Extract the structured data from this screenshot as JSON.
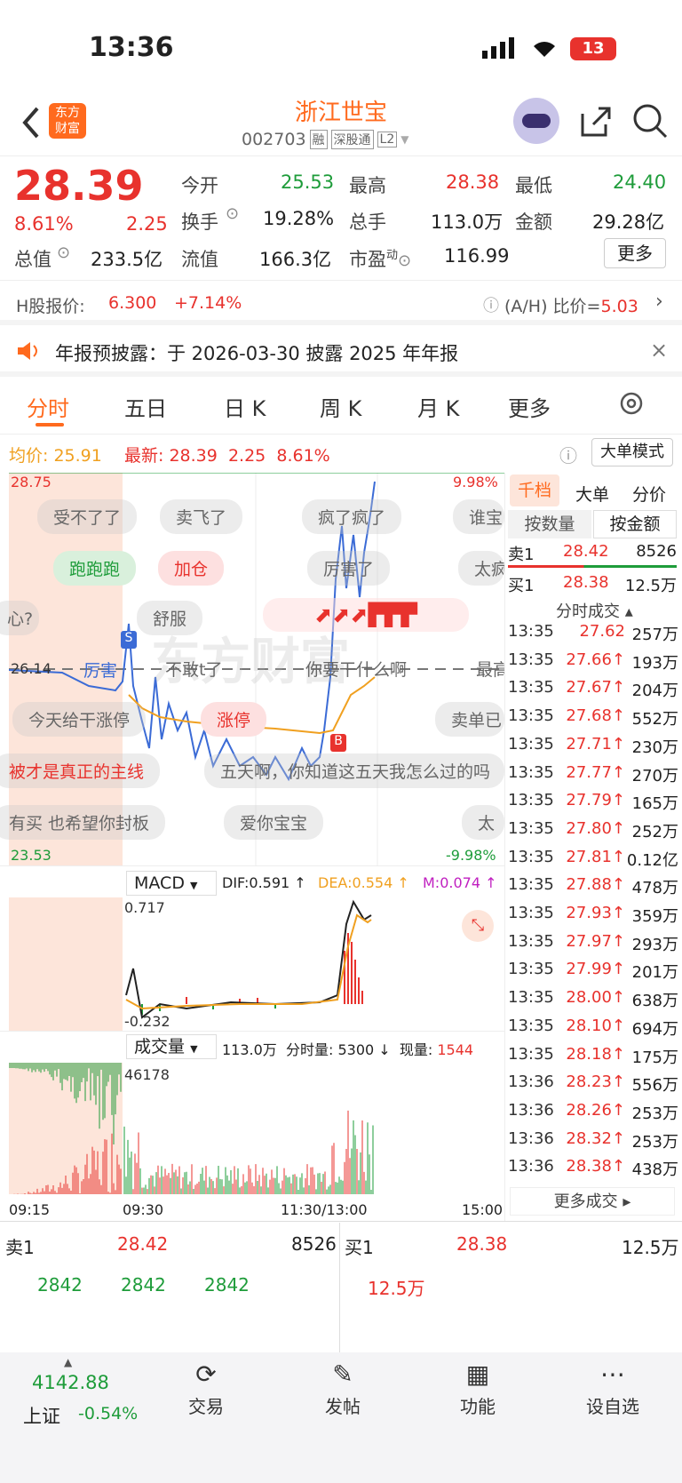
{
  "status": {
    "time": "13:36",
    "battery": "13"
  },
  "header": {
    "logo_line1": "东方",
    "logo_line2": "财富",
    "title": "浙江世宝",
    "code": "002703",
    "tag1": "融",
    "tag2": "深股通",
    "tag3": "L2"
  },
  "quote": {
    "price": "28.39",
    "pct": "8.61%",
    "chg": "2.25",
    "today_open_label": "今开",
    "today_open": "25.53",
    "high_label": "最高",
    "high": "28.38",
    "low_label": "最低",
    "low": "24.40",
    "turnover_label": "换手",
    "turnover": "19.28%",
    "vol_label": "总手",
    "vol": "113.0万",
    "amount_label": "金额",
    "amount": "29.28亿",
    "mcap_label": "总值",
    "mcap": "233.5亿",
    "float_label": "流值",
    "float": "166.3亿",
    "pe_label": "市盈",
    "pe_sup": "动",
    "pe": "116.99",
    "more": "更多"
  },
  "h_share": {
    "label": "H股报价:",
    "price": "6.300",
    "pct": "+7.14%",
    "ah_label": "(A/H) 比价=",
    "ah": "5.03"
  },
  "notice": {
    "text": "年报预披露：于 2026-03-30 披露 2025 年年报"
  },
  "tabs": [
    "分时",
    "五日",
    "日 K",
    "周 K",
    "月 K",
    "更多"
  ],
  "chart_header": {
    "avg_label": "均价:",
    "avg": "25.91",
    "latest_label": "最新:",
    "latest": "28.39",
    "chg": "2.25",
    "pct": "8.61%",
    "mode": "大单模式"
  },
  "chart_labels": {
    "top": "28.75",
    "bottom": "23.53",
    "top_pct": "9.98%",
    "bottom_pct": "-9.98%",
    "ref": "26.14",
    "s": "S",
    "b": "B",
    "watermark": "东方财富"
  },
  "bullets": [
    "受不了了",
    "卖飞了",
    "疯了疯了",
    "谁宝",
    "跑跑跑",
    "加仓",
    "厉害了",
    "太疯",
    "心?",
    "舒服",
    "厉害",
    "不敢t了",
    "你要干什么啊",
    "最高",
    "今天给干涨停",
    "涨停",
    "卖单已",
    "被才是真正的主线",
    "五天啊，你知道这五天我怎么过的吗",
    "有买 也希望你封板",
    "爱你宝宝",
    "太"
  ],
  "macd": {
    "label": "MACD",
    "dif": "DIF:0.591 ↑",
    "dea": "DEA:0.554 ↑",
    "m": "M:0.074 ↑",
    "top": "0.717",
    "bottom": "-0.232"
  },
  "volume": {
    "label": "成交量",
    "total": "113.0万",
    "fs": "分时量: 5300 ↓",
    "cur_label": "现量:",
    "cur": "1544",
    "top": "46178"
  },
  "time_axis": [
    "09:15",
    "09:30",
    "11:30/13:00",
    "15:00"
  ],
  "side": {
    "tabs": [
      "千档",
      "大单",
      "分价"
    ],
    "sub": [
      "按数量",
      "按金额"
    ],
    "sell1": {
      "label": "卖1",
      "price": "28.42",
      "vol": "8526"
    },
    "buy1": {
      "label": "买1",
      "price": "28.38",
      "vol": "12.5万"
    },
    "ticks_title": "分时成交",
    "more": "更多成交"
  },
  "ticks": [
    [
      "13:35",
      "27.62",
      "257万"
    ],
    [
      "13:35",
      "27.66↑",
      "193万"
    ],
    [
      "13:35",
      "27.67↑",
      "204万"
    ],
    [
      "13:35",
      "27.68↑",
      "552万"
    ],
    [
      "13:35",
      "27.71↑",
      "230万"
    ],
    [
      "13:35",
      "27.77↑",
      "270万"
    ],
    [
      "13:35",
      "27.79↑",
      "165万"
    ],
    [
      "13:35",
      "27.80↑",
      "252万"
    ],
    [
      "13:35",
      "27.81↑",
      "0.12亿"
    ],
    [
      "13:35",
      "27.88↑",
      "478万"
    ],
    [
      "13:35",
      "27.93↑",
      "359万"
    ],
    [
      "13:35",
      "27.97↑",
      "293万"
    ],
    [
      "13:35",
      "27.99↑",
      "201万"
    ],
    [
      "13:35",
      "28.00↑",
      "638万"
    ],
    [
      "13:35",
      "28.10↑",
      "694万"
    ],
    [
      "13:35",
      "28.18↑",
      "175万"
    ],
    [
      "13:36",
      "28.23↑",
      "556万"
    ],
    [
      "13:36",
      "28.26↑",
      "253万"
    ],
    [
      "13:36",
      "28.32↑",
      "253万"
    ],
    [
      "13:36",
      "28.38↑",
      "438万"
    ]
  ],
  "book": {
    "sell_label": "卖1",
    "sell_price": "28.42",
    "sell_vol": "8526",
    "buy_label": "买1",
    "buy_price": "28.38",
    "buy_vol": "12.5万",
    "q1": "2842",
    "q2": "2842",
    "q3": "2842",
    "q4": "12.5万"
  },
  "bottom_nav": {
    "index_value": "4142.88",
    "index_name": "上证",
    "index_pct": "-0.54%",
    "trade": "交易",
    "post": "发帖",
    "func": "功能",
    "watch": "设自选"
  }
}
